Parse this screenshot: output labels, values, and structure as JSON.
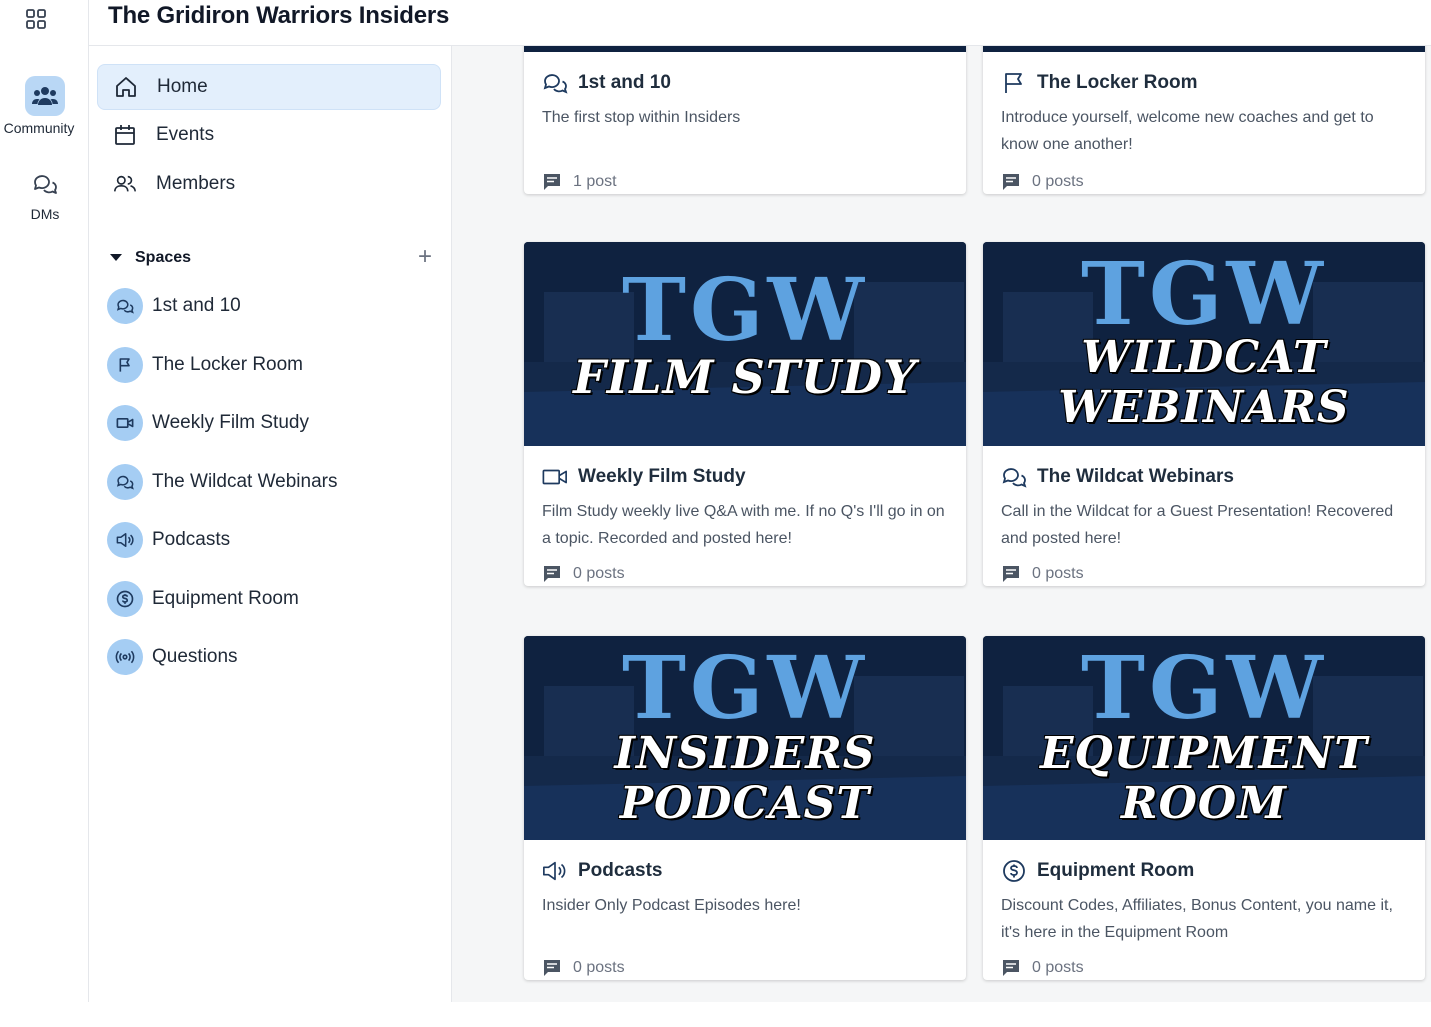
{
  "app": {
    "title": "The Gridiron Warriors Insiders"
  },
  "rail": {
    "items": [
      {
        "label": "Community",
        "icon": "community-icon",
        "active": true
      },
      {
        "label": "DMs",
        "icon": "chat-bubbles-icon",
        "active": false
      }
    ]
  },
  "nav": [
    {
      "label": "Home",
      "icon": "home-icon",
      "active": true
    },
    {
      "label": "Events",
      "icon": "calendar-icon",
      "active": false
    },
    {
      "label": "Members",
      "icon": "members-icon",
      "active": false
    }
  ],
  "spaces": {
    "heading": "Spaces",
    "add_label": "+",
    "items": [
      {
        "label": "1st and 10",
        "icon": "chat-bubbles-icon"
      },
      {
        "label": "The Locker Room",
        "icon": "flag-icon"
      },
      {
        "label": "Weekly Film Study",
        "icon": "video-icon"
      },
      {
        "label": "The Wildcat Webinars",
        "icon": "chat-bubbles-icon"
      },
      {
        "label": "Podcasts",
        "icon": "speaker-icon"
      },
      {
        "label": "Equipment Room",
        "icon": "dollar-icon"
      },
      {
        "label": "Questions",
        "icon": "broadcast-icon"
      }
    ]
  },
  "cards": [
    {
      "title": "1st and 10",
      "icon": "chat-bubbles-icon",
      "description": "The first stop within Insiders",
      "posts": "1 post"
    },
    {
      "title": "The Locker Room",
      "icon": "flag-icon",
      "description": "Introduce yourself, welcome new coaches and get to know one another!",
      "posts": "0 posts"
    },
    {
      "title": "Weekly Film Study",
      "icon": "video-icon",
      "description": "Film Study weekly live Q&A with me. If no Q's I'll go in on a topic. Recorded and posted here!",
      "posts": "0 posts",
      "banner_logo": "TGW",
      "banner_text": [
        "FILM STUDY"
      ]
    },
    {
      "title": "The Wildcat Webinars",
      "icon": "chat-bubbles-icon",
      "description": "Call in the Wildcat for a Guest Presentation! Recovered and posted here!",
      "posts": "0 posts",
      "banner_logo": "TGW",
      "banner_text": [
        "WILDCAT",
        "WEBINARS"
      ]
    },
    {
      "title": "Podcasts",
      "icon": "speaker-icon",
      "description": "Insider Only Podcast Episodes here!",
      "posts": "0 posts",
      "banner_logo": "TGW",
      "banner_text": [
        "INSIDERS",
        "PODCAST"
      ]
    },
    {
      "title": "Equipment Room",
      "icon": "dollar-icon",
      "description": "Discount Codes, Affiliates, Bonus Content, you name it, it's here in the Equipment Room",
      "posts": "0 posts",
      "banner_logo": "TGW",
      "banner_text": [
        "EQUIPMENT",
        "ROOM"
      ]
    }
  ],
  "colors": {
    "accent": "#a5cdf3",
    "active_bg": "#e3effc",
    "banner_blue": "#5ea2e0",
    "banner_dark": "#0f2240"
  }
}
